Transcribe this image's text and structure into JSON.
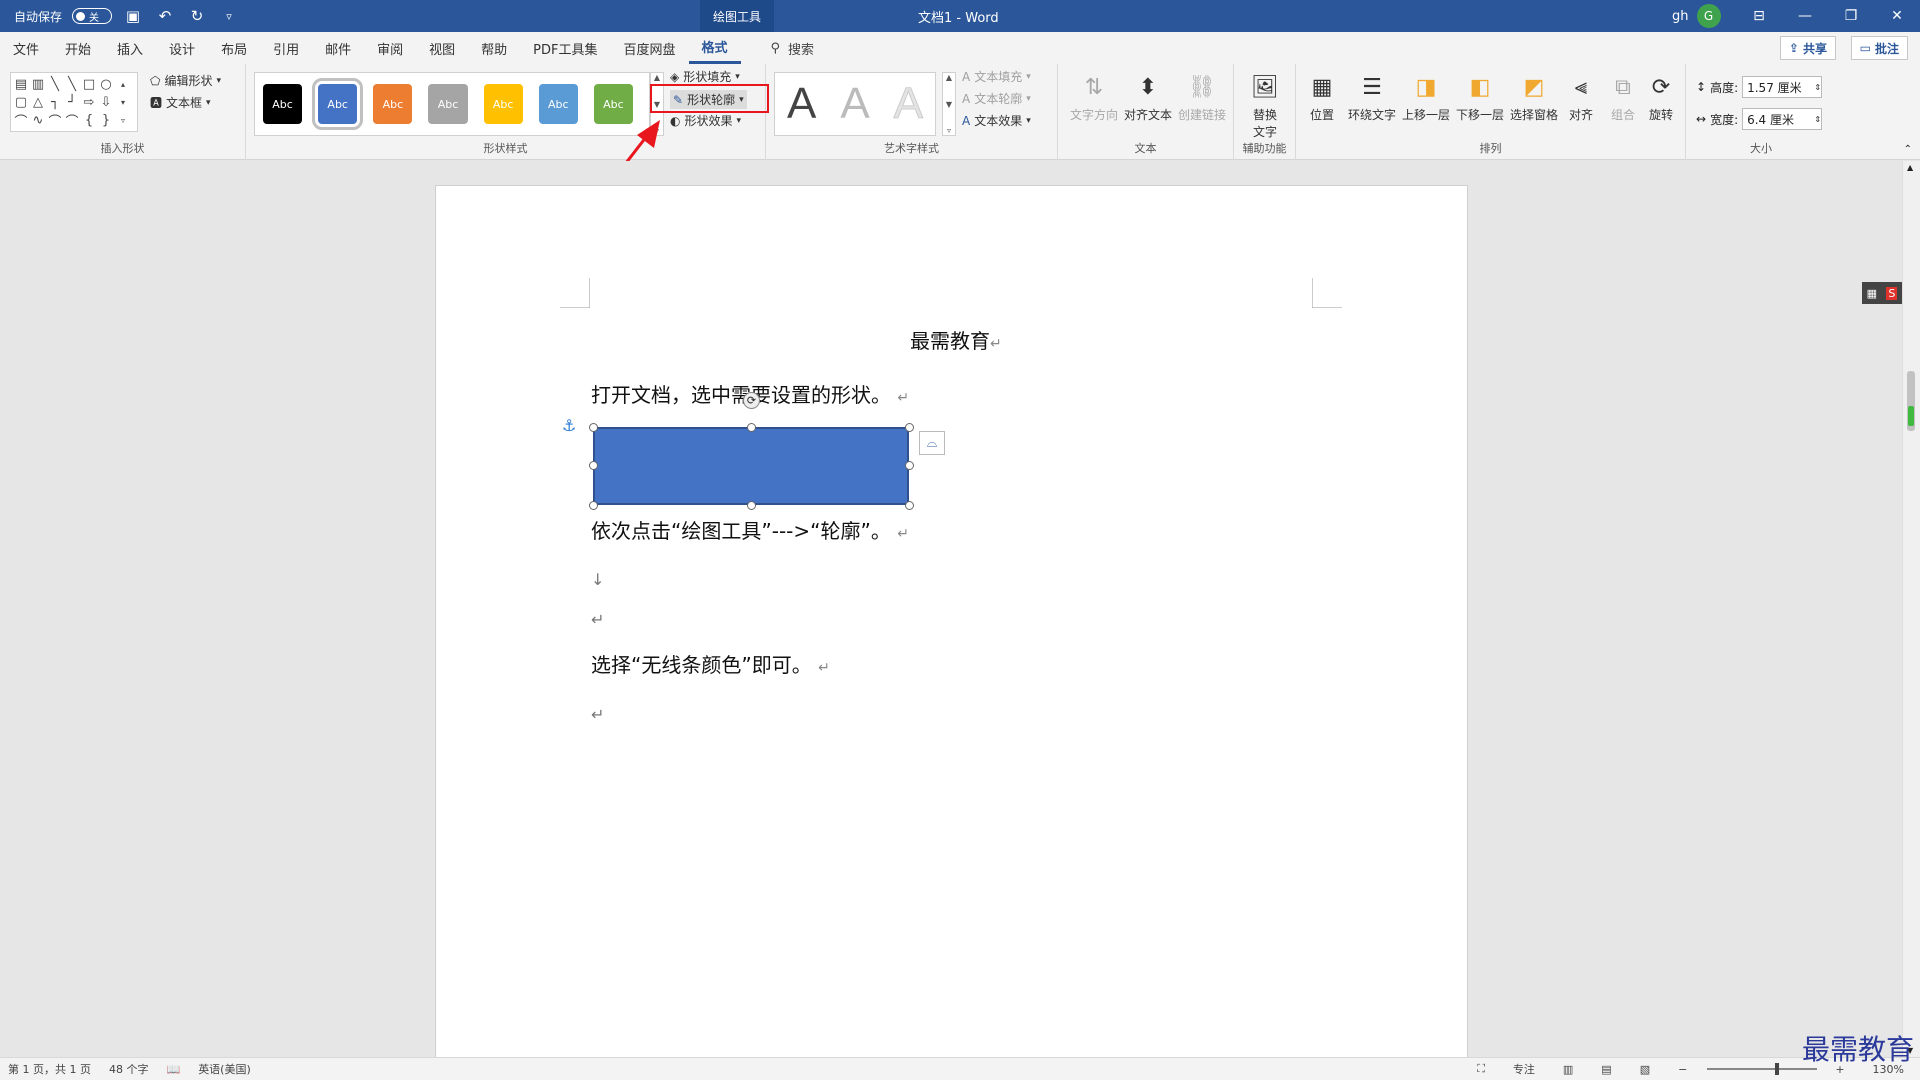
{
  "titlebar": {
    "autosave_label": "自动保存",
    "autosave_state": "关",
    "context_tab": "绘图工具",
    "doc_title": "文档1 - Word",
    "user_initials": "gh",
    "avatar_letter": "G"
  },
  "tabs": [
    "文件",
    "开始",
    "插入",
    "设计",
    "布局",
    "引用",
    "邮件",
    "审阅",
    "视图",
    "帮助",
    "PDF工具集",
    "百度网盘",
    "格式"
  ],
  "active_tab": "格式",
  "search_label": "搜索",
  "share_label": "共享",
  "comment_label": "批注",
  "ribbon": {
    "insert_shapes": {
      "label": "插入形状",
      "edit_shape": "编辑形状",
      "text_box": "文本框"
    },
    "shape_styles": {
      "label": "形状样式",
      "swatch_text": "Abc",
      "swatch_colors": [
        "#000000",
        "#4472c4",
        "#ed7d31",
        "#a5a5a5",
        "#ffc000",
        "#5b9bd5",
        "#70ad47"
      ],
      "fill": "形状填充",
      "outline": "形状轮廓",
      "effects": "形状效果"
    },
    "wordart": {
      "label": "艺术字样式",
      "letter": "A",
      "text_fill": "文本填充",
      "text_outline": "文本轮廓",
      "text_effects": "文本效果"
    },
    "text_group": {
      "label": "文本",
      "direction": "文字方向",
      "align": "对齐文本",
      "link": "创建链接"
    },
    "accessibility": {
      "label": "辅助功能",
      "alt_text": "替换文字"
    },
    "arrange": {
      "label": "排列",
      "items": [
        "位置",
        "环绕文字",
        "上移一层",
        "下移一层",
        "选择窗格",
        "对齐",
        "组合",
        "旋转"
      ]
    },
    "size": {
      "label": "大小",
      "height_label": "高度:",
      "height_value": "1.57 厘米",
      "width_label": "宽度:",
      "width_value": "6.4 厘米"
    }
  },
  "document": {
    "title": "最需教育",
    "line1": "打开文档，选中需要设置的形状。",
    "line2": "依次点击“绘图工具”--->“轮廓”。",
    "line3": "选择“无线条颜色”即可。",
    "shape_color": "#4472c4"
  },
  "status": {
    "page": "第 1 页，共 1 页",
    "words": "48 个字",
    "language": "英语(美国)",
    "focus": "专注",
    "zoom": "130%"
  },
  "watermark": "最需教育",
  "annotation_color": "#e8161d"
}
